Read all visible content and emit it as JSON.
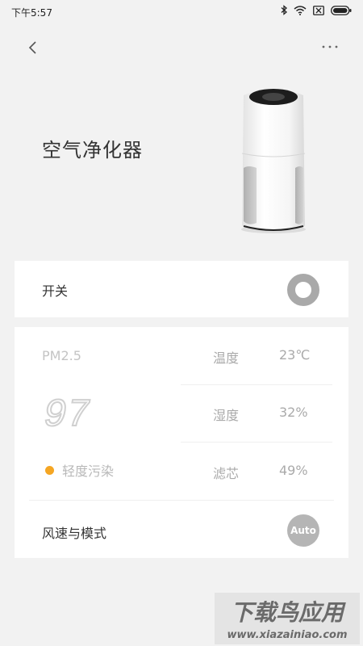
{
  "status_bar": {
    "time": "下午5:57",
    "icons": [
      "bluetooth-icon",
      "wifi-icon",
      "sim-blocked-icon",
      "battery-icon"
    ]
  },
  "nav": {
    "back_icon": "chevron-left-icon",
    "more_icon": "more-dots-icon"
  },
  "device": {
    "title": "空气净化器"
  },
  "power": {
    "label": "开关",
    "state": "off"
  },
  "air_quality": {
    "pm_label": "PM2.5",
    "pm_value": "97",
    "pollution_level": "轻度污染",
    "pollution_color": "#f5a623"
  },
  "metrics": [
    {
      "name": "温度",
      "value": "23℃"
    },
    {
      "name": "湿度",
      "value": "32%"
    },
    {
      "name": "滤芯",
      "value": "49%"
    }
  ],
  "mode": {
    "label": "风速与模式",
    "button": "Auto"
  },
  "watermark": {
    "title": "下载鸟应用",
    "url": "www.xiazainiao.com"
  }
}
